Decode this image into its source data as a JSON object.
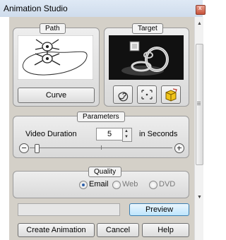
{
  "window": {
    "title": "Animation Studio"
  },
  "path_group": {
    "caption": "Path",
    "curve_button": "Curve"
  },
  "target_group": {
    "caption": "Target"
  },
  "parameters": {
    "caption": "Parameters",
    "duration_label": "Video Duration",
    "duration_value": "5",
    "unit_label": "in Seconds",
    "slider_level": 0.05
  },
  "quality": {
    "caption": "Quality",
    "options": [
      "Email",
      "Web",
      "DVD"
    ],
    "selected": "Email"
  },
  "buttons": {
    "preview": "Preview",
    "create": "Create Animation",
    "cancel": "Cancel",
    "help": "Help"
  },
  "icons": [
    "close-icon",
    "spiral-icon",
    "dot-frame-icon",
    "box-icon",
    "zoom-out-icon",
    "zoom-in-icon",
    "spin-up-icon",
    "spin-down-icon"
  ]
}
